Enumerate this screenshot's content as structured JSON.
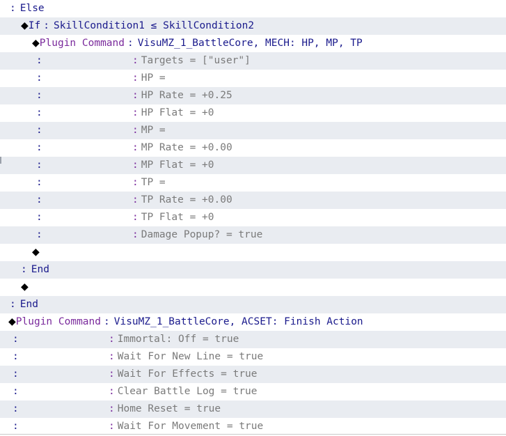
{
  "rows": [
    {
      "type": "kw",
      "indent": 14,
      "text": "Else"
    },
    {
      "type": "cond",
      "indent": 30,
      "kw": "If",
      "text": "SkillCondition1 ≤ SkillCondition2"
    },
    {
      "type": "plugin",
      "indent": 46,
      "label": "Plugin Command",
      "text": "VisuMZ_1_BattleCore, MECH: HP, MP, TP"
    },
    {
      "type": "sub",
      "indent": 46,
      "subcol": 190,
      "text": "Targets = [\"user\"]"
    },
    {
      "type": "sub",
      "indent": 46,
      "subcol": 190,
      "text": "HP ="
    },
    {
      "type": "sub",
      "indent": 46,
      "subcol": 190,
      "text": "HP Rate = +0.25"
    },
    {
      "type": "sub",
      "indent": 46,
      "subcol": 190,
      "text": "HP Flat = +0"
    },
    {
      "type": "sub",
      "indent": 46,
      "subcol": 190,
      "text": "MP ="
    },
    {
      "type": "sub",
      "indent": 46,
      "subcol": 190,
      "text": "MP Rate = +0.00"
    },
    {
      "type": "sub",
      "indent": 46,
      "subcol": 190,
      "text": "MP Flat = +0"
    },
    {
      "type": "sub",
      "indent": 46,
      "subcol": 190,
      "text": "TP ="
    },
    {
      "type": "sub",
      "indent": 46,
      "subcol": 190,
      "text": "TP Rate = +0.00"
    },
    {
      "type": "sub",
      "indent": 46,
      "subcol": 190,
      "text": "TP Flat = +0"
    },
    {
      "type": "sub",
      "indent": 46,
      "subcol": 190,
      "text": "Damage Popup? = true"
    },
    {
      "type": "empty",
      "indent": 46
    },
    {
      "type": "kw",
      "indent": 30,
      "text": "End"
    },
    {
      "type": "empty",
      "indent": 30
    },
    {
      "type": "kw",
      "indent": 14,
      "text": "End"
    },
    {
      "type": "plugin",
      "indent": 12,
      "label": "Plugin Command",
      "text": "VisuMZ_1_BattleCore, ACSET: Finish Action"
    },
    {
      "type": "sub",
      "indent": 12,
      "subcol": 156,
      "text": "Immortal: Off = true"
    },
    {
      "type": "sub",
      "indent": 12,
      "subcol": 156,
      "text": "Wait For New Line = true"
    },
    {
      "type": "sub",
      "indent": 12,
      "subcol": 156,
      "text": "Wait For Effects = true"
    },
    {
      "type": "sub",
      "indent": 12,
      "subcol": 156,
      "text": "Clear Battle Log = true"
    },
    {
      "type": "sub",
      "indent": 12,
      "subcol": 156,
      "text": "Home Reset = true"
    },
    {
      "type": "sub",
      "indent": 12,
      "subcol": 156,
      "text": "Wait For Movement = true"
    }
  ],
  "symbols": {
    "colon": ":",
    "diamond": "◆"
  },
  "colors": {
    "keyword": "#1a1a8c",
    "plugin_label": "#7a2a9c",
    "sub_text": "#7a7a7a",
    "row_alt": "#e9ecf1"
  }
}
